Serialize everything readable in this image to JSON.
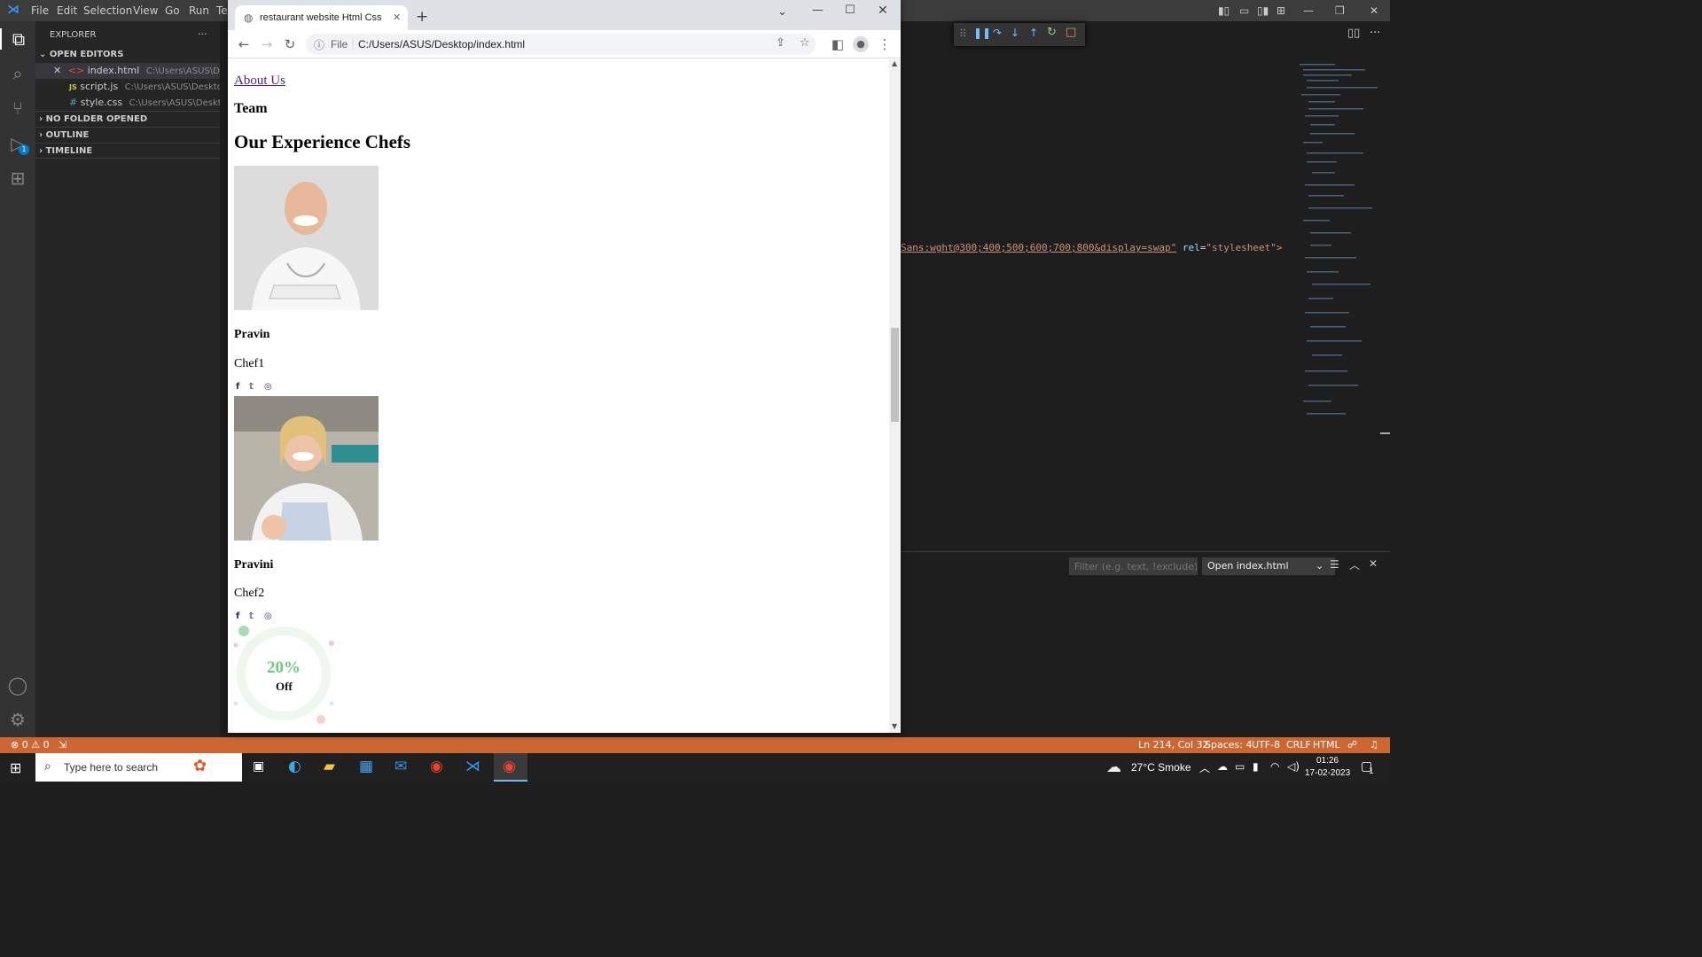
{
  "vscode": {
    "menu": [
      "File",
      "Edit",
      "Selection",
      "View",
      "Go",
      "Run",
      "Te"
    ],
    "explorer": {
      "title": "EXPLORER",
      "more": "···",
      "open_editors_label": "OPEN EDITORS",
      "files": [
        {
          "name": "index.html",
          "path": "C:\\Users\\ASUS\\Desktop",
          "icon": "html-icon"
        },
        {
          "name": "script.js",
          "path": "C:\\Users\\ASUS\\Desktop",
          "icon": "js-icon"
        },
        {
          "name": "style.css",
          "path": "C:\\Users\\ASUS\\Desktop",
          "icon": "css-icon"
        }
      ],
      "sections": [
        "NO FOLDER OPENED",
        "OUTLINE",
        "TIMELINE"
      ]
    },
    "code_line": {
      "attr_value": "Sans:wght@300;400;500;600;700;800&display=swap\"",
      "attr_name": "rel",
      "attr_eq": "=",
      "attr_rel_value": "\"stylesheet\">"
    },
    "panel": {
      "filter_placeholder": "Filter (e.g. text, !exclude)",
      "dropdown": "Open index.html"
    },
    "status": {
      "problems": "⊗ 0 ⚠ 0",
      "position": "Ln 214, Col 32",
      "spaces": "Spaces: 4",
      "encoding": "UTF-8",
      "eol": "CRLF",
      "language": "HTML"
    },
    "debug_badge": "1",
    "accent": "#cc6633"
  },
  "chrome": {
    "tab_title": "restaurant website Html Css",
    "url_label": "File",
    "url": "C:/Users/ASUS/Desktop/index.html"
  },
  "page": {
    "about_link": "About Us",
    "team_heading": "Team",
    "chefs_heading": "Our Experience Chefs",
    "chefs": [
      {
        "name": "Pravin",
        "role": "Chef1"
      },
      {
        "name": "Pravini",
        "role": "Chef2"
      }
    ],
    "social_icons": [
      "f",
      "𝕥",
      "◎"
    ],
    "offer": {
      "percent": "20%",
      "label": "Off"
    }
  },
  "taskbar": {
    "search_placeholder": "Type here to search",
    "weather": "27°C  Smoke",
    "time": "01:26",
    "date": "17-02-2023",
    "notification_count": "1"
  }
}
